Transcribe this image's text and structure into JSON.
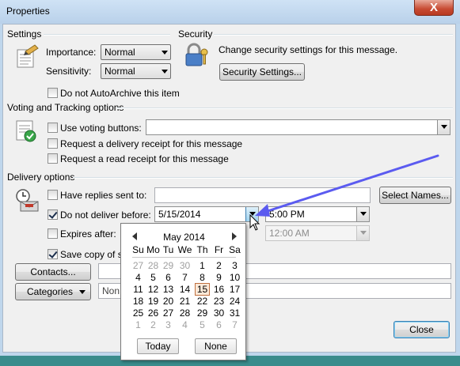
{
  "window": {
    "title": "Properties",
    "close_glyph": "X"
  },
  "settings": {
    "group_title": "Settings",
    "importance_label": "Importance:",
    "importance_value": "Normal",
    "sensitivity_label": "Sensitivity:",
    "sensitivity_value": "Normal",
    "no_autoarchive_label": "Do not AutoArchive this item"
  },
  "security": {
    "group_title": "Security",
    "description": "Change security settings for this message.",
    "button_label": "Security Settings..."
  },
  "voting": {
    "group_title": "Voting and Tracking options",
    "use_voting_label": "Use voting buttons:",
    "voting_value": "",
    "delivery_receipt_label": "Request a delivery receipt for this message",
    "read_receipt_label": "Request a read receipt for this message"
  },
  "delivery": {
    "group_title": "Delivery options",
    "replies_label": "Have replies sent to:",
    "replies_value": "",
    "select_names_label": "Select Names...",
    "defer_label": "Do not deliver before:",
    "defer_date": "5/15/2014",
    "defer_time": "5:00 PM",
    "expires_label": "Expires after:",
    "expires_time": "12:00 AM",
    "save_copy_label": "Save copy of se",
    "contacts_label": "Contacts...",
    "contacts_value": "",
    "categories_label": "Categories",
    "categories_value": "Non",
    "close_label": "Close"
  },
  "calendar": {
    "month_label": "May 2014",
    "dow": [
      "Su",
      "Mo",
      "Tu",
      "We",
      "Th",
      "Fr",
      "Sa"
    ],
    "weeks": [
      [
        "27",
        "28",
        "29",
        "30",
        "1",
        "2",
        "3"
      ],
      [
        "4",
        "5",
        "6",
        "7",
        "8",
        "9",
        "10"
      ],
      [
        "11",
        "12",
        "13",
        "14",
        "15",
        "16",
        "17"
      ],
      [
        "18",
        "19",
        "20",
        "21",
        "22",
        "23",
        "24"
      ],
      [
        "25",
        "26",
        "27",
        "28",
        "29",
        "30",
        "31"
      ],
      [
        "1",
        "2",
        "3",
        "4",
        "5",
        "6",
        "7"
      ]
    ],
    "selected_day": "15",
    "today_label": "Today",
    "none_label": "None"
  },
  "colors": {
    "annotation_arrow": "#5b5bf0",
    "selected_day_border": "#c07040"
  }
}
